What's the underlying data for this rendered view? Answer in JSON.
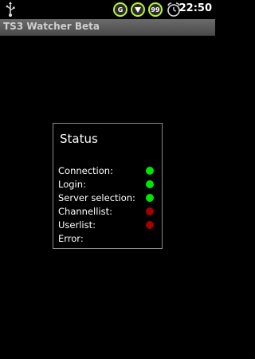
{
  "statusbar": {
    "icons": [
      {
        "name": "g-icon",
        "text": "G"
      },
      {
        "name": "signal-icon",
        "text": ""
      },
      {
        "name": "battery-icon",
        "text": "99"
      }
    ],
    "time": "22:50"
  },
  "app": {
    "title": "TS3 Watcher Beta"
  },
  "dialog": {
    "title": "Status",
    "rows": [
      {
        "label": "Connection:",
        "state": "ok",
        "color": "#00e600"
      },
      {
        "label": "Login:",
        "state": "ok",
        "color": "#00e600"
      },
      {
        "label": "Server selection:",
        "state": "ok",
        "color": "#00e600"
      },
      {
        "label": "Channellist:",
        "state": "error",
        "color": "#a30000"
      },
      {
        "label": "Userlist:",
        "state": "error",
        "color": "#a30000"
      },
      {
        "label": "Error:",
        "state": "none",
        "color": ""
      }
    ]
  }
}
